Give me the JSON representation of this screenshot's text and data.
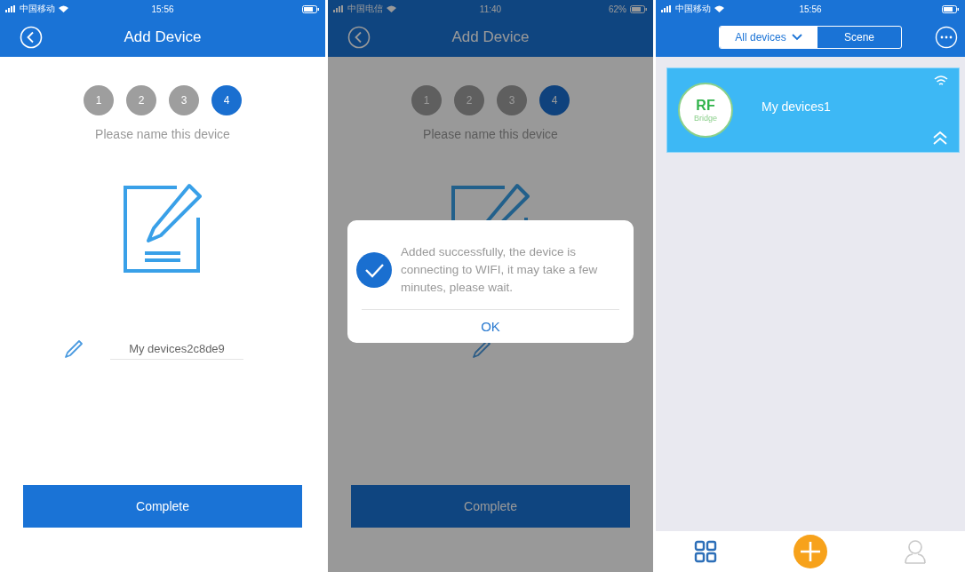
{
  "screens": [
    {
      "kind": "name",
      "status": {
        "carrier": "中国移动",
        "time": "15:56"
      },
      "title": "Add Device",
      "steps": [
        {
          "label": "1",
          "selected": false
        },
        {
          "label": "2",
          "selected": false
        },
        {
          "label": "3",
          "selected": false
        },
        {
          "label": "4",
          "selected": true
        }
      ],
      "hint": "Please name this device",
      "name_value": "My devices2c8de9",
      "button": "Complete"
    },
    {
      "kind": "name",
      "status": {
        "carrier": "中国电信",
        "time": "11:40",
        "battery": "62%"
      },
      "title": "Add Device",
      "steps": [
        {
          "label": "1",
          "selected": false
        },
        {
          "label": "2",
          "selected": false
        },
        {
          "label": "3",
          "selected": false
        },
        {
          "label": "4",
          "selected": true
        }
      ],
      "hint": "Please name this device",
      "button": "Complete",
      "dialog": {
        "message": "Added successfully, the device is connecting to WIFI, it may take a few minutes, please wait.",
        "ok": "OK"
      }
    },
    {
      "kind": "list",
      "status": {
        "carrier": "中国移动",
        "time": "15:56"
      },
      "segments": [
        {
          "label": "All devices",
          "selected": true
        },
        {
          "label": "Scene",
          "selected": false
        }
      ],
      "devices": [
        {
          "name": "My devices1",
          "badge_top": "RF",
          "badge_bottom": "Bridge"
        }
      ],
      "tabs": [
        {
          "kind": "devices",
          "selected": true
        },
        {
          "kind": "add",
          "selected": false
        },
        {
          "kind": "profile",
          "selected": false
        }
      ]
    }
  ]
}
